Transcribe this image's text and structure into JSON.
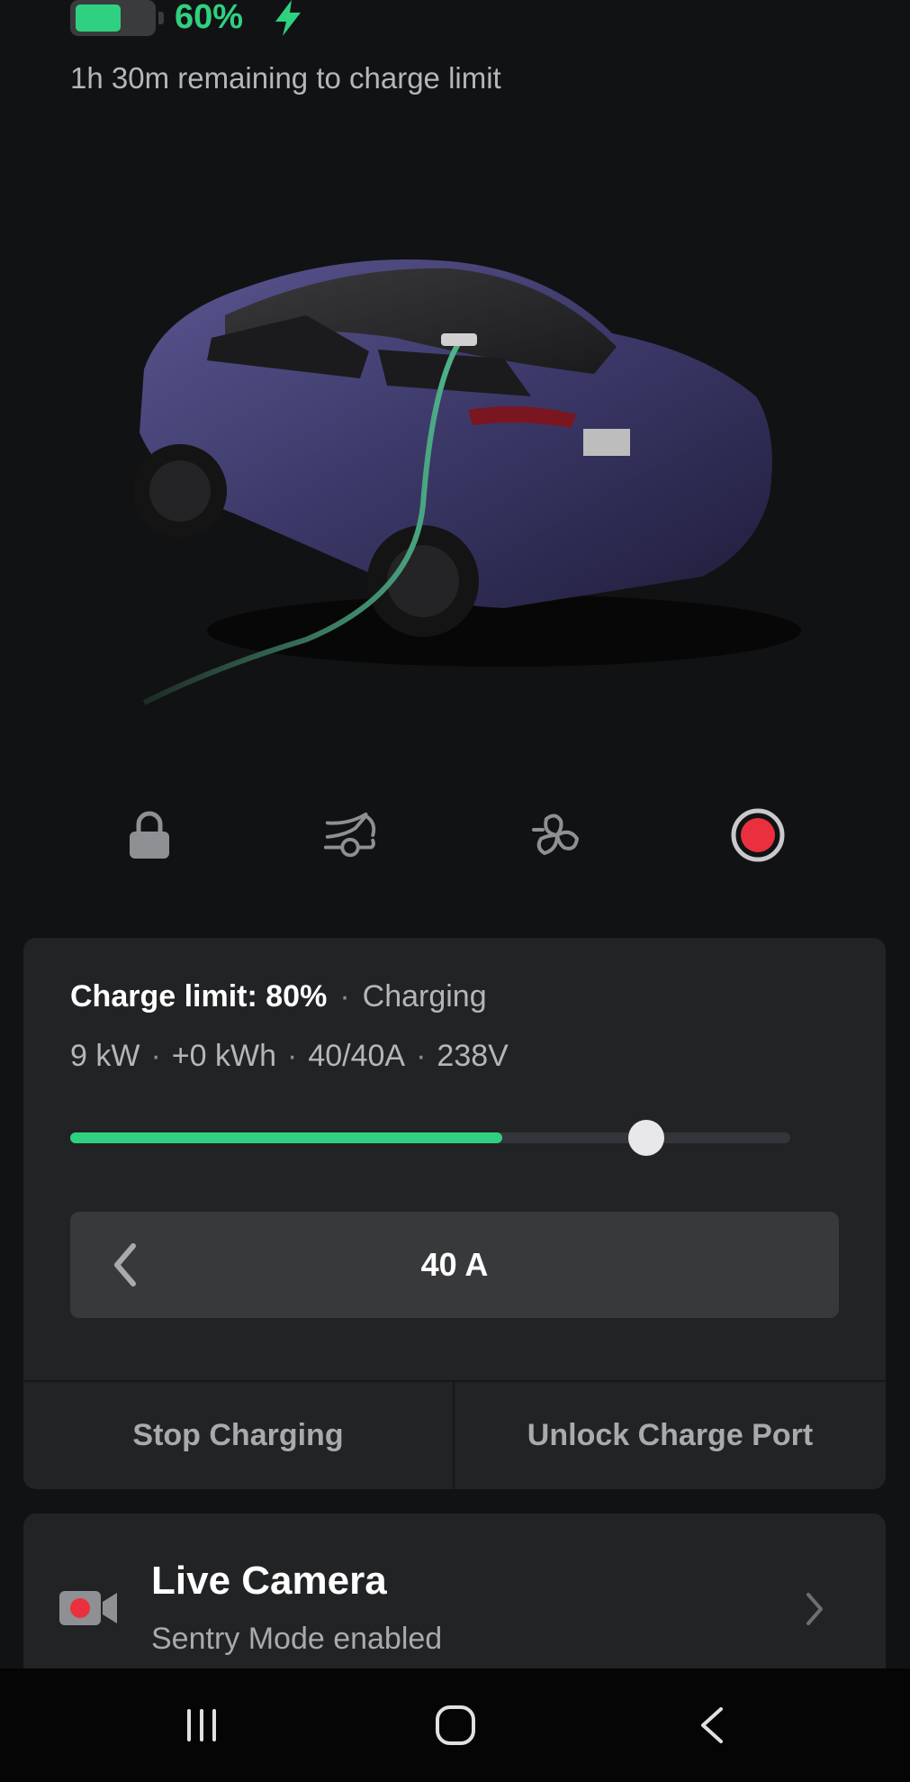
{
  "header": {
    "battery_level": 0.6,
    "battery_percent": "60%",
    "remaining": "1h 30m remaining to charge limit",
    "accent_color": "#2fd181"
  },
  "quick_controls": [
    {
      "name": "lock-icon"
    },
    {
      "name": "trunk-icon"
    },
    {
      "name": "fan-icon"
    },
    {
      "name": "sentry-record-icon"
    }
  ],
  "charging": {
    "limit_label": "Charge limit: 80%",
    "status": "Charging",
    "power": "9 kW",
    "energy_added": "+0 kWh",
    "current": "40/40A",
    "voltage": "238V",
    "charge_level": 0.6,
    "charge_limit": 0.8,
    "amperage": "40 A",
    "stop_label": "Stop Charging",
    "unlock_label": "Unlock Charge Port"
  },
  "camera": {
    "title": "Live Camera",
    "subtitle": "Sentry Mode enabled",
    "record_color": "#ea2f3f"
  },
  "navbar": {
    "items": [
      {
        "name": "recent-apps-icon"
      },
      {
        "name": "home-icon"
      },
      {
        "name": "back-icon"
      }
    ]
  }
}
